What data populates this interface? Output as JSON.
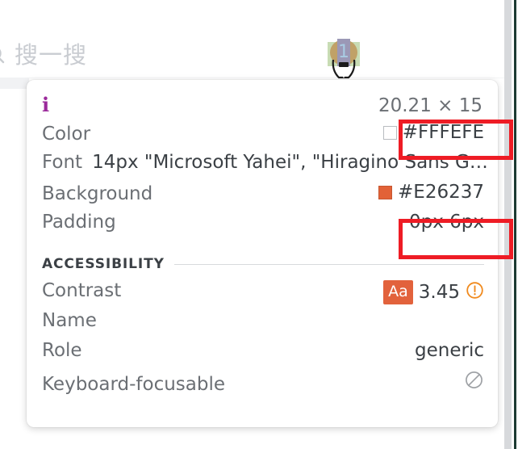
{
  "page": {
    "search": {
      "icon": "search-icon",
      "text": "搜一搜"
    },
    "highlighted_element": {
      "badge_number": "1"
    }
  },
  "tooltip": {
    "element_tag": "i",
    "dimensions": "20.21 × 15",
    "style_rows": [
      {
        "label": "Color",
        "value": "#FFFEFE",
        "swatch": "#FFFEFE",
        "highlighted": true
      },
      {
        "label": "Font",
        "value": "14px \"Microsoft Yahei\", \"Hiragino Sans G…",
        "swatch": null,
        "highlighted": false
      },
      {
        "label": "Background",
        "value": "#E26237",
        "swatch": "#E26237",
        "highlighted": false
      },
      {
        "label": "Padding",
        "value": "0px 6px",
        "swatch": null,
        "highlighted": true
      }
    ],
    "accessibility": {
      "title": "ACCESSIBILITY",
      "rows": [
        {
          "label": "Contrast",
          "badge": "Aa",
          "value": "3.45",
          "status_icon": "warning-circle-icon"
        },
        {
          "label": "Name",
          "badge": null,
          "value": "",
          "status_icon": null
        },
        {
          "label": "Role",
          "badge": null,
          "value": "generic",
          "status_icon": null
        },
        {
          "label": "Keyboard-focusable",
          "badge": null,
          "value": "",
          "status_icon": "not-allowed-icon"
        }
      ]
    }
  },
  "colors": {
    "tag_purple": "#9B2A9B",
    "label_grey": "#6B6F74",
    "value_grey": "#3B4045",
    "accent_orange": "#E2623C",
    "annotation_red": "#EE1C25",
    "swatch_white": "#FFFEFE",
    "swatch_orange": "#E26237"
  }
}
